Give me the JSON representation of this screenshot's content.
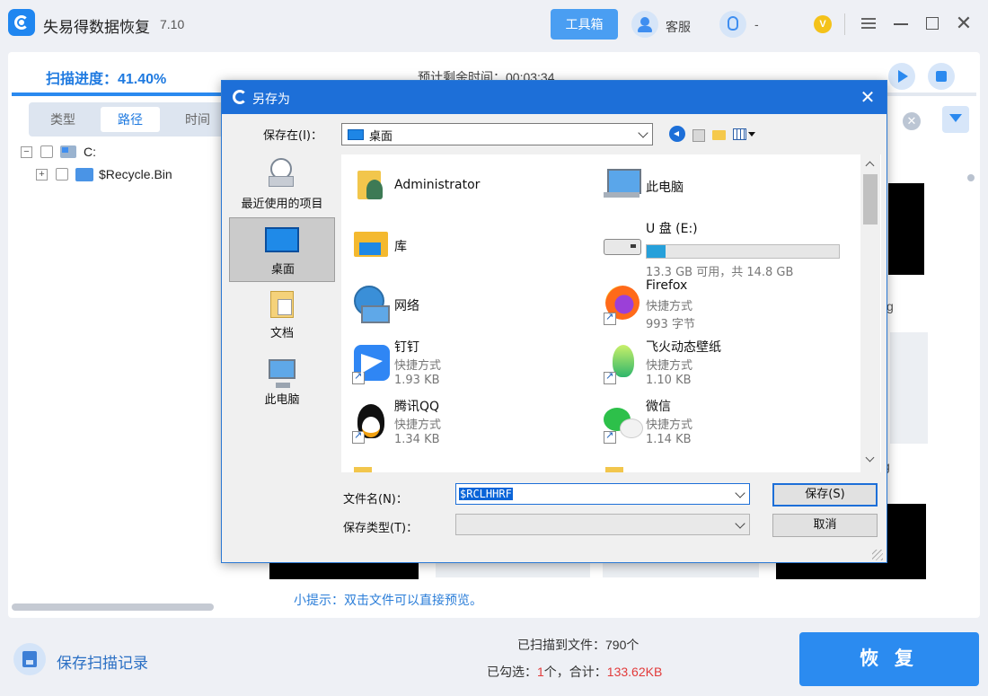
{
  "app": {
    "title": "失易得数据恢复",
    "version": "7.10",
    "toolbox_label": "工具箱",
    "support_label": "客服",
    "qq_label": "-",
    "vip_badge": "V"
  },
  "scan": {
    "progress_label": "扫描进度：41.40%",
    "progress_value": 41.4,
    "eta_label": "预计剩余时间：00:03:34"
  },
  "tabs": [
    "类型",
    "路径",
    "时间"
  ],
  "tree": {
    "root_label": "C:",
    "child_label": "$Recycle.Bin"
  },
  "tip": "小提示：双击文件可以直接预览。",
  "footer": {
    "save_log_label": "保存扫描记录",
    "scanned_label": "已扫描到文件：790个",
    "checked_prefix": "已勾选：",
    "checked_count": "1",
    "checked_mid": "个，合计：",
    "checked_size": "133.62KB",
    "recover_label": "恢 复"
  },
  "dialog": {
    "title": "另存为",
    "save_in_label": "保存在(I)：",
    "save_in_value": "桌面",
    "places": [
      "最近使用的项目",
      "桌面",
      "文档",
      "此电脑"
    ],
    "items": [
      {
        "name": "Administrator"
      },
      {
        "name": "此电脑"
      },
      {
        "name": "库"
      },
      {
        "name": "U 盘 (E:)",
        "capacity": "13.3 GB 可用，共 14.8 GB",
        "used_fraction": 0.1
      },
      {
        "name": "网络"
      },
      {
        "name": "Firefox",
        "type": "快捷方式",
        "size": "993 字节"
      },
      {
        "name": "钉钉",
        "type": "快捷方式",
        "size": "1.93 KB"
      },
      {
        "name": "飞火动态壁纸",
        "type": "快捷方式",
        "size": "1.10 KB"
      },
      {
        "name": "腾讯QQ",
        "type": "快捷方式",
        "size": "1.34 KB"
      },
      {
        "name": "微信",
        "type": "快捷方式",
        "size": "1.14 KB"
      }
    ],
    "filename_label": "文件名(N)：",
    "filename_value": "$RCLHHRF",
    "filetype_label": "保存类型(T)：",
    "filetype_value": "",
    "save_button": "保存(S)",
    "cancel_button": "取消"
  },
  "peek": {
    "g1": "g",
    "g2": "g"
  },
  "colors": {
    "accent": "#2b8bf0",
    "dialog_title": "#1d6fd8",
    "highlight_red": "#e23a3a"
  }
}
